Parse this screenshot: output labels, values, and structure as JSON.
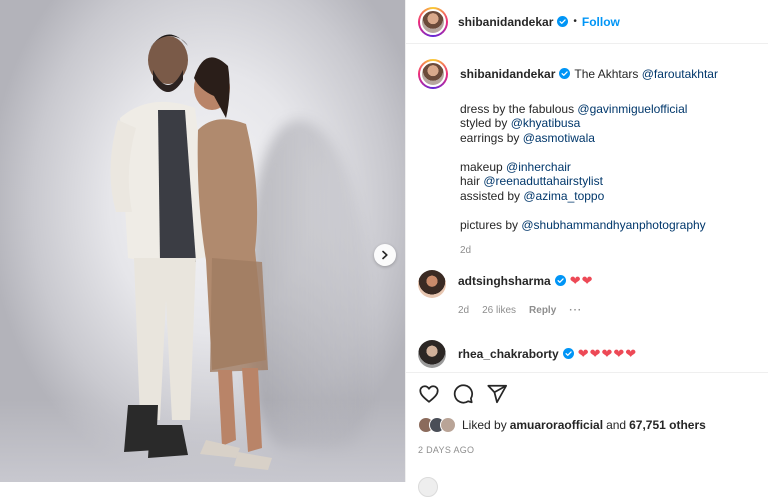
{
  "header": {
    "username": "shibanidandekar",
    "separator": "•",
    "follow_label": "Follow"
  },
  "caption": {
    "username": "shibanidandekar",
    "first_line_text": "The Akhtars",
    "first_line_mention": "@faroutakhtar",
    "lines": [
      {
        "text": "dress by the fabulous ",
        "mention": "@gavinmiguelofficial"
      },
      {
        "text": "styled by ",
        "mention": "@khyatibusa"
      },
      {
        "text": "earrings by ",
        "mention": "@asmotiwala"
      },
      null,
      {
        "text": "makeup ",
        "mention": "@inherchair"
      },
      {
        "text": "hair ",
        "mention": "@reenaduttahairstylist"
      },
      {
        "text": "assisted by ",
        "mention": "@azima_toppo"
      },
      null,
      {
        "text": "pictures by ",
        "mention": "@shubhammandhyanphotography"
      }
    ],
    "age": "2d"
  },
  "comments": [
    {
      "username": "adtsinghsharma",
      "text": "❤❤",
      "age": "2d",
      "likes": "26 likes",
      "reply_label": "Reply",
      "more": "···"
    },
    {
      "username": "rhea_chakraborty",
      "text": "❤❤❤❤❤"
    }
  ],
  "likes": {
    "prefix": "Liked by ",
    "user": "amuaroraofficial",
    "mid": " and ",
    "count": "67,751 others"
  },
  "timestamp": "2 DAYS AGO",
  "colors": {
    "accent": "#0095f6",
    "mention": "#00376b",
    "heart": "#ed4956",
    "muted": "#8e8e8e"
  }
}
